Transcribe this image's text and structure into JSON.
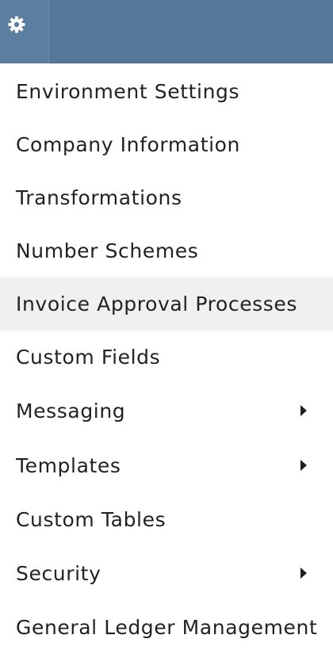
{
  "menu": {
    "items": [
      {
        "label": "Environment Settings",
        "has_submenu": false,
        "highlighted": false
      },
      {
        "label": "Company Information",
        "has_submenu": false,
        "highlighted": false
      },
      {
        "label": "Transformations",
        "has_submenu": false,
        "highlighted": false
      },
      {
        "label": "Number Schemes",
        "has_submenu": false,
        "highlighted": false
      },
      {
        "label": "Invoice Approval Processes",
        "has_submenu": false,
        "highlighted": true
      },
      {
        "label": "Custom Fields",
        "has_submenu": false,
        "highlighted": false
      },
      {
        "label": "Messaging",
        "has_submenu": true,
        "highlighted": false
      },
      {
        "label": "Templates",
        "has_submenu": true,
        "highlighted": false
      },
      {
        "label": "Custom Tables",
        "has_submenu": false,
        "highlighted": false
      },
      {
        "label": "Security",
        "has_submenu": true,
        "highlighted": false
      },
      {
        "label": "General Ledger Management",
        "has_submenu": false,
        "highlighted": false
      }
    ]
  },
  "header": {
    "icon": "gear-icon"
  },
  "colors": {
    "header_bg": "#56789b",
    "highlight_bg": "#f0f0f0",
    "text": "#222222"
  }
}
